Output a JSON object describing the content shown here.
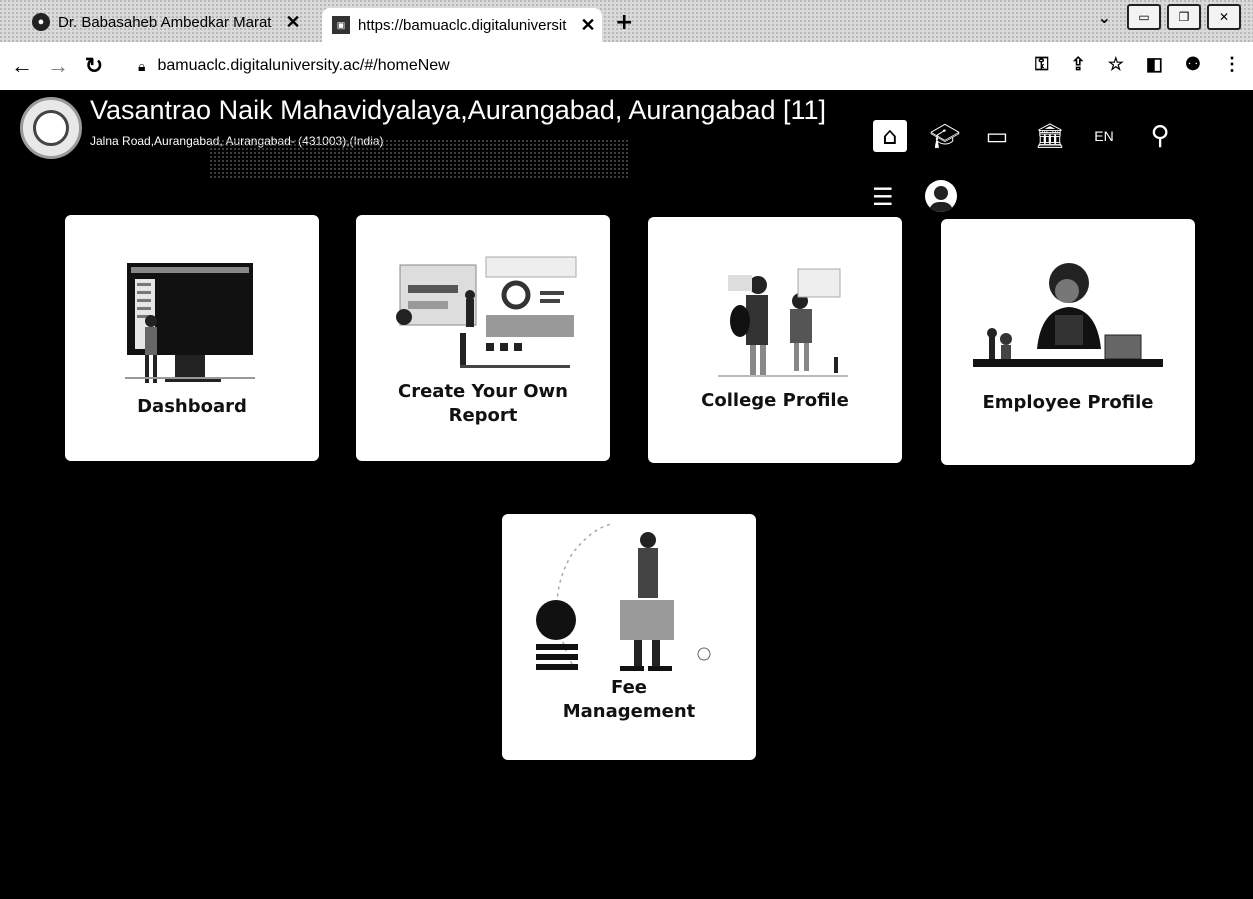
{
  "browser": {
    "tabs": [
      {
        "title": "Dr. Babasaheb Ambedkar Marat",
        "active": false
      },
      {
        "title": "https://bamuaclc.digitaluniversit",
        "active": true
      }
    ],
    "new_tab_label": "+",
    "url": "bamuaclc.digitaluniversity.ac/#/homeNew"
  },
  "header": {
    "college_name": "Vasantrao Naik Mahavidyalaya,Aurangabad, Aurangabad [11]",
    "college_address": "Jalna Road,Aurangabad, Aurangabad- (431003),(India)",
    "language": "EN"
  },
  "tiles": [
    {
      "label": "Dashboard"
    },
    {
      "label_line1": "Create Your Own",
      "label_line2": "Report"
    },
    {
      "label": "College Profile"
    },
    {
      "label": "Employee Profile"
    },
    {
      "label_line1": "Fee",
      "label_line2": "Management"
    }
  ],
  "colors": {
    "page_background": "#000000",
    "tile_background": "#ffffff",
    "text": "#111111"
  }
}
